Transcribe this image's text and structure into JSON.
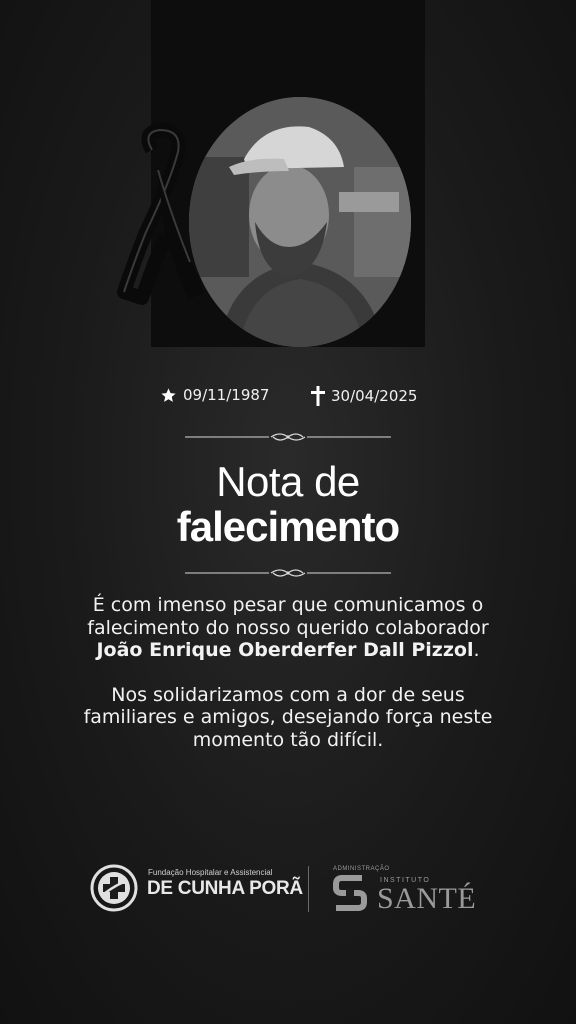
{
  "dates": {
    "birth": "09/11/1987",
    "death": "30/04/2025"
  },
  "title": {
    "line1": "Nota de",
    "line2": "falecimento"
  },
  "message": {
    "p1_start": "É com imenso pesar que comunicamos o falecimento do nosso querido colaborador ",
    "p1_name": "João Enrique Oberderfer Dall Pizzol",
    "p1_end": ".",
    "p2": "Nos solidarizamos com a dor de seus familiares e amigos, desejando força neste momento tão difícil."
  },
  "footer": {
    "hospital_subtitle": "Fundação Hospitalar e Assistencial",
    "hospital_name": "DE CUNHA PORÃ",
    "admin_label": "ADMINISTRAÇÃO",
    "institute_label": "INSTITUTO",
    "institute_name": "SANTÉ"
  },
  "icons": {
    "birth": "star-icon",
    "death": "cross-icon",
    "mourning": "black-ribbon-icon"
  },
  "colors": {
    "background": "#1a1a1a",
    "band": "#0d0d0d",
    "text": "#ffffff"
  }
}
